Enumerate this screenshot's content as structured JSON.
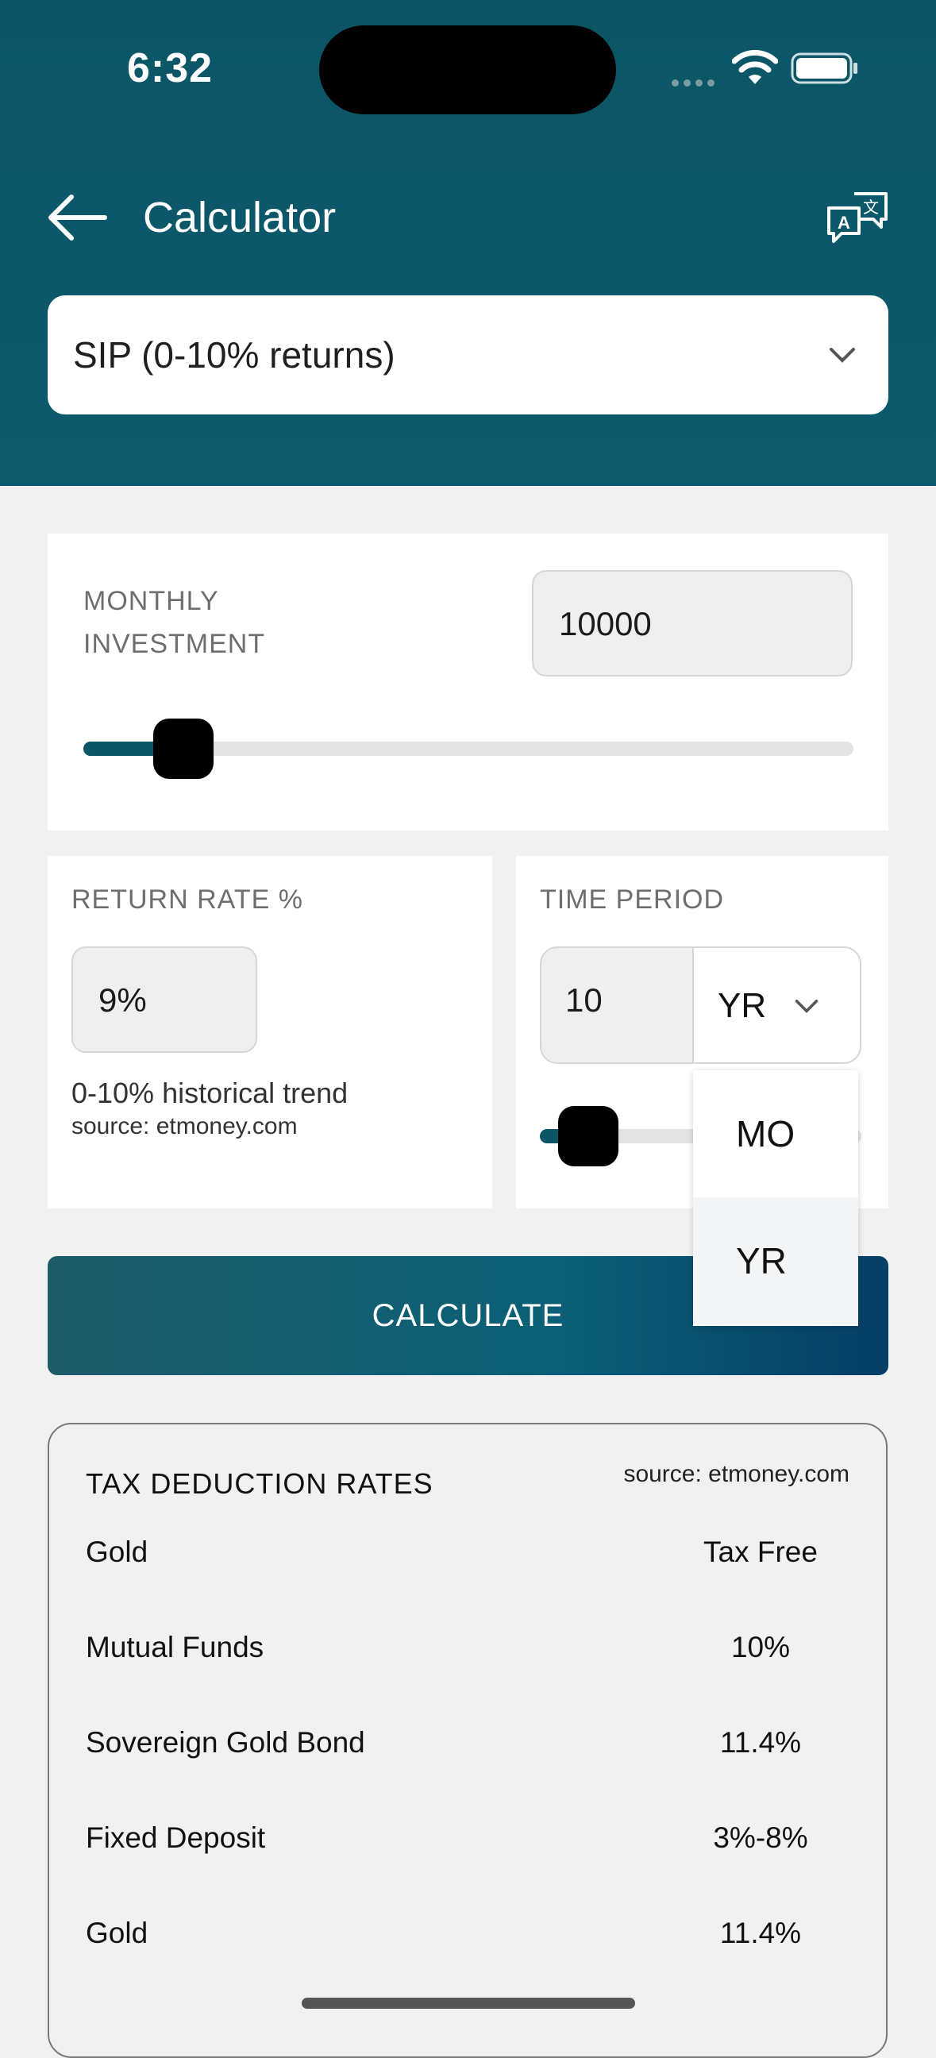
{
  "status_bar": {
    "time": "6:32"
  },
  "header": {
    "title": "Calculator"
  },
  "calculator_type": {
    "selected": "SIP (0-10% returns)"
  },
  "monthly_investment": {
    "label_line1": "MONTHLY",
    "label_line2": "INVESTMENT",
    "value": "10000",
    "slider_fraction": 0.13
  },
  "return_rate": {
    "label": "RETURN RATE %",
    "value": "9%",
    "note": "0-10% historical trend",
    "source": "source: etmoney.com"
  },
  "time_period": {
    "label": "TIME PERIOD",
    "value": "10",
    "unit": "YR",
    "options": [
      "MO",
      "YR"
    ],
    "selected_option": "YR",
    "slider_fraction": 0.15
  },
  "calculate_button": {
    "label": "CALCULATE"
  },
  "tax_rates": {
    "title": "TAX DEDUCTION RATES",
    "source": "source: etmoney.com",
    "rows": [
      {
        "name": "Gold",
        "rate": "Tax Free"
      },
      {
        "name": "Mutual Funds",
        "rate": "10%"
      },
      {
        "name": "Sovereign Gold Bond",
        "rate": "11.4%"
      },
      {
        "name": "Fixed Deposit",
        "rate": "3%-8%"
      },
      {
        "name": "Gold",
        "rate": "11.4%"
      }
    ]
  },
  "colors": {
    "header_bg": "#0b5566",
    "accent": "#0a5566",
    "slider_thumb": "#000000"
  }
}
